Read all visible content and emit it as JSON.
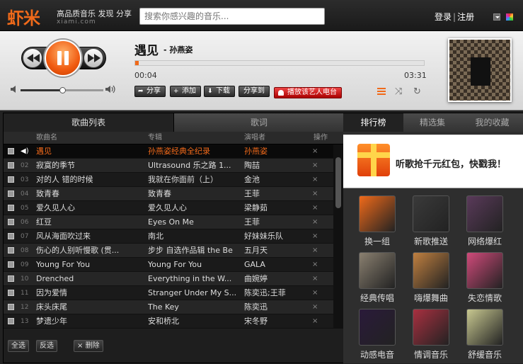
{
  "header": {
    "logo": "虾米",
    "slogan": "高品质音乐 发现 分享",
    "brand_sub": "xiami.com",
    "search_placeholder": "搜索你感兴趣的音乐...",
    "login": "登录",
    "register": "注册",
    "separator": "|"
  },
  "player": {
    "song_title": "遇见",
    "song_artist": "- 孙燕姿",
    "time_current": "00:04",
    "time_total": "03:31",
    "progress_fraction": 0.013,
    "volume_fraction": 0.5,
    "actions": {
      "share": "分享",
      "add": "添加",
      "download": "下载",
      "share_to": "分享到",
      "radio": "播放该艺人电台"
    }
  },
  "left": {
    "tab_songlist": "歌曲列表",
    "tab_lyrics": "歌词",
    "headers": {
      "song": "歌曲名",
      "album": "专辑",
      "artist": "演唱者",
      "op": "操作"
    },
    "rows": [
      {
        "num": "01",
        "song": "遇见",
        "album": "孙燕姿经典全纪录",
        "artist": "孙燕姿",
        "current": true
      },
      {
        "num": "02",
        "song": "寂寞的季节",
        "album": "Ultrasound 乐之路 1...",
        "artist": "陶喆"
      },
      {
        "num": "03",
        "song": "对的人 错的时候",
        "album": "我就在你面前（上）",
        "artist": "金池"
      },
      {
        "num": "04",
        "song": "致青春",
        "album": "致青春",
        "artist": "王菲"
      },
      {
        "num": "05",
        "song": "爱久见人心",
        "album": "爱久见人心",
        "artist": "梁静茹"
      },
      {
        "num": "06",
        "song": "红豆",
        "album": "Eyes On Me",
        "artist": "王菲"
      },
      {
        "num": "07",
        "song": "风从海面吹过来",
        "album": "南北",
        "artist": "好妹妹乐队"
      },
      {
        "num": "08",
        "song": "伤心的人别听慢歌 (贯...",
        "album": "步步 自选作品辑 the Be",
        "artist": "五月天"
      },
      {
        "num": "09",
        "song": "Young For You",
        "album": "Young For You",
        "artist": "GALA"
      },
      {
        "num": "10",
        "song": "Drenched",
        "album": "Everything in the W...",
        "artist": "曲婉婷"
      },
      {
        "num": "11",
        "song": "因为爱情",
        "album": "Stranger Under My S...",
        "artist": "陈奕迅;王菲"
      },
      {
        "num": "12",
        "song": "床头床尾",
        "album": "The Key",
        "artist": "陈奕迅"
      },
      {
        "num": "13",
        "song": "梦遗少年",
        "album": "安和桥北",
        "artist": "宋冬野"
      }
    ],
    "delete_mark": "×",
    "footer": {
      "select_all": "全选",
      "invert": "反选",
      "delete": "删除"
    }
  },
  "right": {
    "tabs": [
      "排行榜",
      "精选集",
      "我的收藏"
    ],
    "promo": "听歌抢千元红包，快戳我！",
    "tiles": [
      {
        "label": "换一组",
        "color": "#f06a1a",
        "icon": "refresh-icon"
      },
      {
        "label": "新歌推送",
        "color": "#3a3a3a",
        "icon": "new-top-icon"
      },
      {
        "label": "网络爆红",
        "color": "#5a3a5a",
        "icon": "viral-icon"
      },
      {
        "label": "经典传唱",
        "color": "#8a8070",
        "icon": "classic-icon"
      },
      {
        "label": "嗨爆舞曲",
        "color": "#c08040",
        "icon": "dance-icon"
      },
      {
        "label": "失恋情歌",
        "color": "#d04a7a",
        "icon": "broken-heart-icon"
      },
      {
        "label": "动感电音",
        "color": "#2a1a3a",
        "icon": "electronic-icon"
      },
      {
        "label": "情调音乐",
        "color": "#a83040",
        "icon": "mood-icon"
      },
      {
        "label": "舒缓音乐",
        "color": "#c8c890",
        "icon": "soothing-icon"
      }
    ]
  }
}
